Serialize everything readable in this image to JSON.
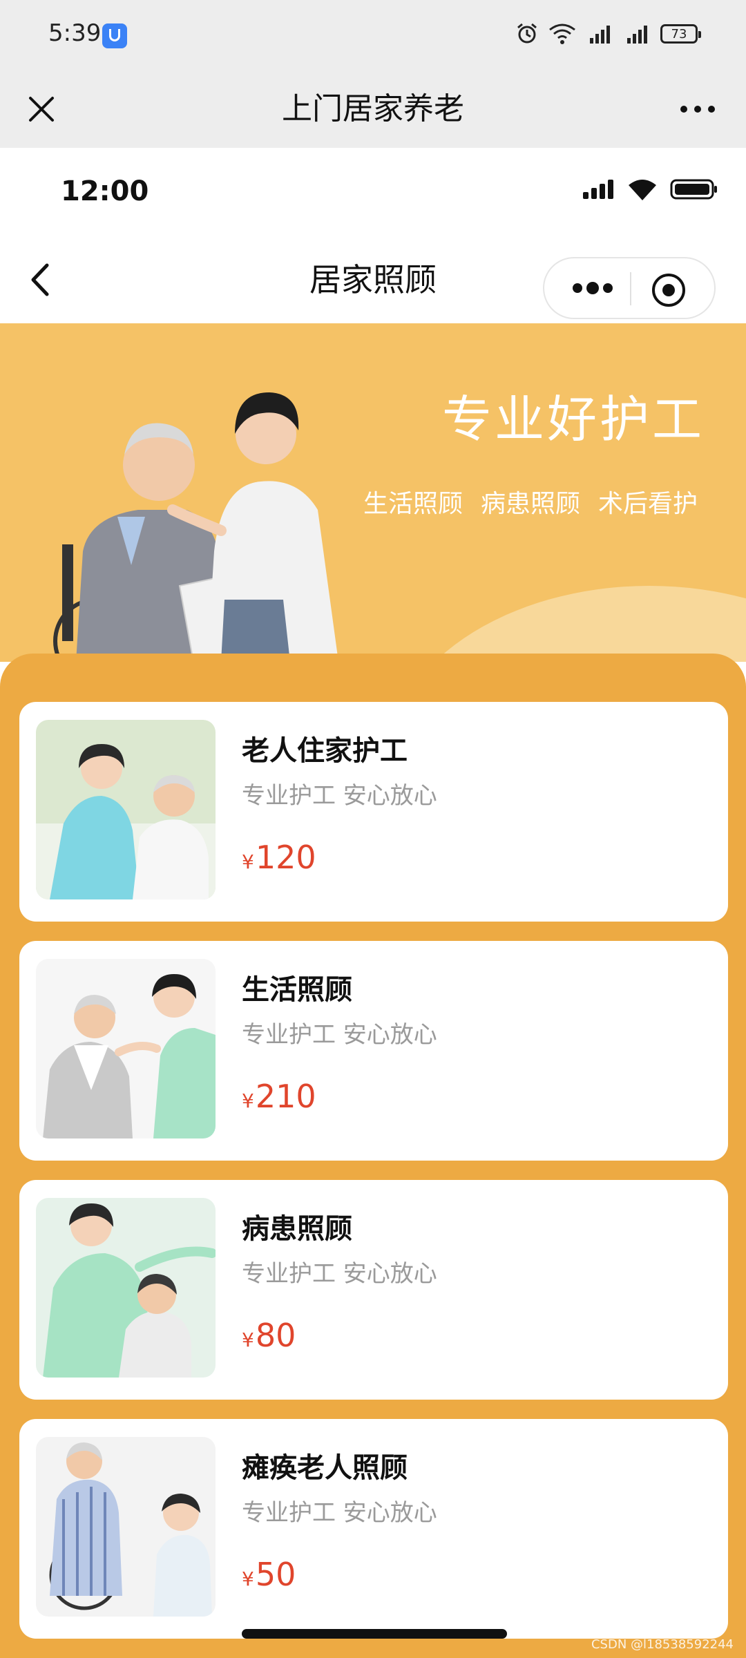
{
  "system_status": {
    "time": "5:39",
    "battery": "73"
  },
  "wechat_bar": {
    "title": "上门居家养老"
  },
  "inner_status": {
    "time": "12:00"
  },
  "nav": {
    "title": "居家照顾"
  },
  "hero": {
    "title": "专业好护工",
    "tags": [
      "生活照顾",
      "病患照顾",
      "术后看护"
    ]
  },
  "services": [
    {
      "name": "老人住家护工",
      "desc": "专业护工 安心放心",
      "currency": "¥",
      "price": "120"
    },
    {
      "name": "生活照顾",
      "desc": "专业护工 安心放心",
      "currency": "¥",
      "price": "210"
    },
    {
      "name": "病患照顾",
      "desc": "专业护工 安心放心",
      "currency": "¥",
      "price": "80"
    },
    {
      "name": "瘫痪老人照顾",
      "desc": "专业护工 安心放心",
      "currency": "¥",
      "price": "50"
    }
  ],
  "watermark": "CSDN @l18538592244",
  "colors": {
    "hero_bg": "#F5C266",
    "content_bg": "#EDAA43",
    "price": "#E0452C"
  }
}
